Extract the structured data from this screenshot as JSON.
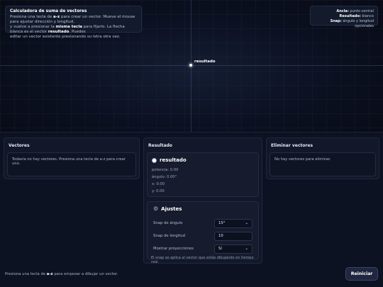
{
  "canvas": {
    "result_label": "resultado"
  },
  "info": {
    "title": "Calculadora de suma de vectores",
    "t1": "Presiona una tecla de ",
    "t1b": "a-z",
    "t2": " para crear un vector. Mueve el mouse para ajustar dirección y longitud,",
    "t3": "y vuelve a presionar la ",
    "t3b": "misma tecla",
    "t4": " para fijarlo. La flecha blanca es el vector ",
    "t4b": "resultado",
    "t5": ". Puedes",
    "t6": "editar un vector existente presionando su letra otra vez."
  },
  "legend": {
    "anchor_key": "Ancla:",
    "anchor_val": " punto central",
    "result_key": "Resultado:",
    "result_val": " blanco",
    "snap_key": "Snap:",
    "snap_val": " ángulo y longitud opcionales"
  },
  "vectors_panel": {
    "title": "Vectores",
    "empty": "Todavía no hay vectores. Presiona una tecla de a-z para crear uno."
  },
  "result_panel": {
    "title": "Resultado",
    "name": "resultado",
    "potencia": "potencia: 0.00",
    "angulo": "ángulo: 0.00°",
    "x": "x: 0.00",
    "y": "y: 0.00"
  },
  "settings": {
    "title": "Ajustes",
    "angle_label": "Snap de ángulo",
    "angle_value": "15°",
    "length_label": "Snap de longitud",
    "length_value": "10",
    "proj_label": "Mostrar proyecciones",
    "proj_value": "Sí",
    "note": "El snap se aplica al vector que estás dibujando en tiempo real."
  },
  "delete_panel": {
    "title": "Eliminar vectores",
    "empty": "No hay vectores para eliminar."
  },
  "status": {
    "pre": "Presiona una tecla de ",
    "key": "a-z",
    "post": " para empezar a dibujar un vector."
  },
  "reset_label": "Reiniciar"
}
